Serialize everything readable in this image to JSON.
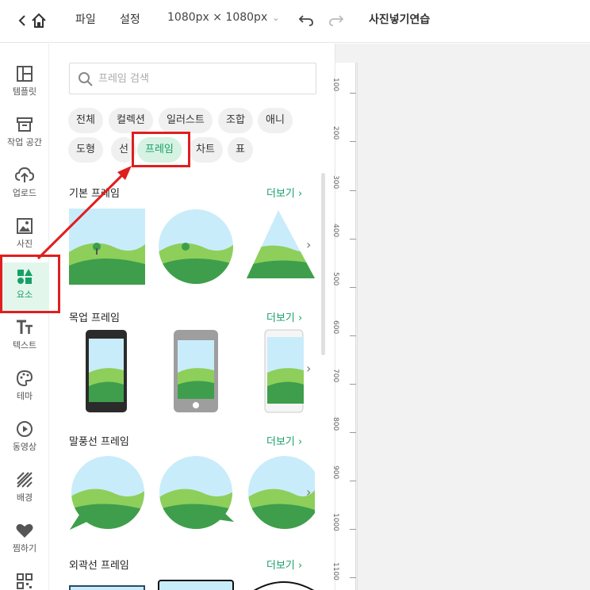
{
  "topbar": {
    "file_label": "파일",
    "settings_label": "설정",
    "size_value": "1080px × 1080px",
    "doc_title": "사진넣기연습"
  },
  "rail": {
    "items": [
      {
        "label": "템플릿",
        "icon": "template-icon"
      },
      {
        "label": "작업 공간",
        "icon": "workspace-icon"
      },
      {
        "label": "업로드",
        "icon": "upload-icon"
      },
      {
        "label": "사진",
        "icon": "photo-icon"
      },
      {
        "label": "요소",
        "icon": "elements-icon",
        "active": true
      },
      {
        "label": "텍스트",
        "icon": "text-icon"
      },
      {
        "label": "테마",
        "icon": "palette-icon"
      },
      {
        "label": "동영상",
        "icon": "video-icon"
      },
      {
        "label": "배경",
        "icon": "background-icon"
      },
      {
        "label": "찜하기",
        "icon": "heart-icon"
      }
    ]
  },
  "panel": {
    "search_placeholder": "프레임 검색",
    "chips": [
      {
        "label": "전체"
      },
      {
        "label": "컬렉션"
      },
      {
        "label": "일러스트"
      },
      {
        "label": "조합"
      },
      {
        "label": "애니"
      },
      {
        "label": "도형"
      },
      {
        "label": "선"
      },
      {
        "label": "프레임",
        "active": true
      },
      {
        "label": "차트"
      },
      {
        "label": "표"
      }
    ],
    "sections": [
      {
        "title": "기본 프레임",
        "more": "더보기"
      },
      {
        "title": "목업 프레임",
        "more": "더보기"
      },
      {
        "title": "말풍선 프레임",
        "more": "더보기"
      },
      {
        "title": "외곽선 프레임",
        "more": "더보기"
      }
    ],
    "more_arrow": "›",
    "next_arrow": "›"
  },
  "ruler": {
    "ticks": [
      "100",
      "200",
      "300",
      "400",
      "500",
      "600",
      "700",
      "800",
      "900",
      "1000",
      "1100"
    ]
  },
  "colors": {
    "accent": "#16a067",
    "accent_bg": "#e3f6ec",
    "annotation": "#e01e1e",
    "sky": "#c9ecfb",
    "hill_light": "#8dcf5a",
    "hill_dark": "#3e9e4c"
  }
}
